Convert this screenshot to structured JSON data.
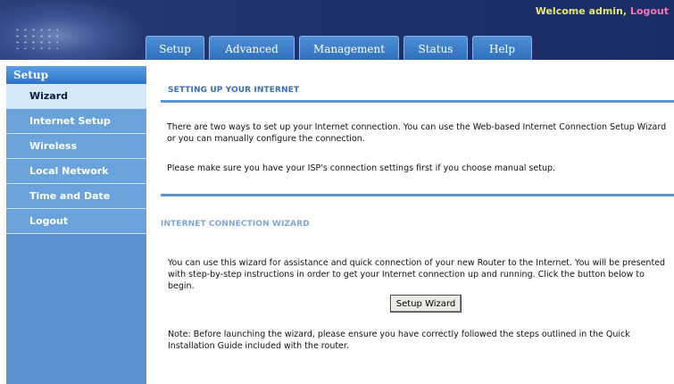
{
  "header": {
    "welcome_text": "Welcome admin,",
    "logout_link": "Logout"
  },
  "tabs": [
    {
      "label": "Setup"
    },
    {
      "label": "Advanced"
    },
    {
      "label": "Management"
    },
    {
      "label": "Status"
    },
    {
      "label": "Help"
    }
  ],
  "sidebar": {
    "title": "Setup",
    "items": [
      {
        "label": "Wizard"
      },
      {
        "label": "Internet Setup"
      },
      {
        "label": "Wireless"
      },
      {
        "label": "Local Network"
      },
      {
        "label": "Time and Date"
      },
      {
        "label": "Logout"
      }
    ]
  },
  "main": {
    "section1": {
      "title": "SETTING UP YOUR INTERNET",
      "para1": "There are two ways to set up your Internet connection. You can use the Web-based Internet Connection Setup Wizard or you can manually configure the connection.",
      "para2": "Please make sure you have your ISP's connection settings first if you choose manual setup."
    },
    "section2": {
      "title": "INTERNET CONNECTION WIZARD",
      "para1": "You can use this wizard for assistance and quick connection of your new Router to the Internet. You will be presented with step-by-step instructions in order to get your Internet connection up and running. Click the button below to begin.",
      "button_label": "Setup Wizard",
      "note": "Note: Before launching the wizard, please ensure you have correctly followed the steps outlined in the Quick Installation Guide included with the router."
    }
  },
  "colors": {
    "header_bg": "#20326c",
    "tab_bg": "#2f6fbd",
    "sidebar_bg": "#5a93cf",
    "active_item_bg": "#d4e9fb",
    "rule_color": "#5e96d2",
    "section_title_color": "#3b6fb3",
    "welcome_color": "#e7e96a",
    "logout_color": "#ff6fb3"
  }
}
